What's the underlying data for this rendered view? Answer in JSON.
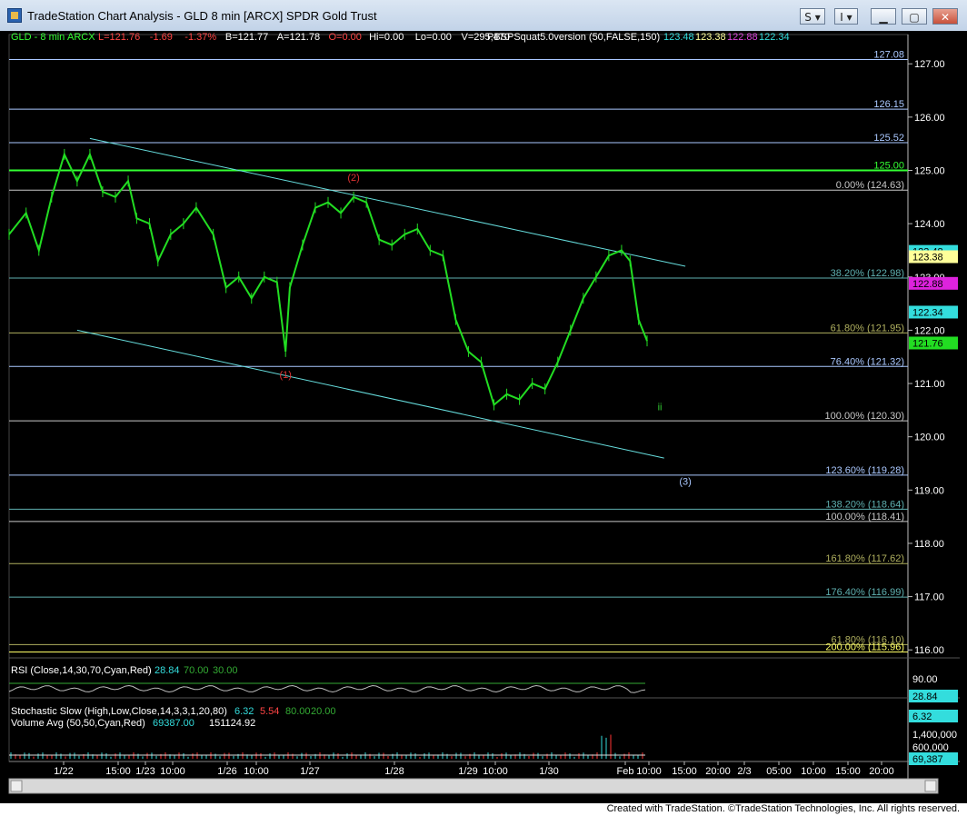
{
  "window": {
    "title": "TradeStation Chart Analysis - GLD 8 min [ARCX] SPDR Gold Trust",
    "btn_s": "S",
    "btn_i": "I",
    "footer": "Created with TradeStation. ©TradeStation Technologies, Inc. All rights reserved."
  },
  "chart_data": {
    "type": "line",
    "symbol": "GLD - 8 min",
    "exchange": "ARCX",
    "header_stats": [
      "L=121.76",
      "-1.69",
      "-1.37%",
      "B=121.77",
      "A=121.78",
      "O=0.00",
      "Hi=0.00",
      "Lo=0.00",
      "V=295,470"
    ],
    "indicator_label": "PBSPSquat5.0version (50,FALSE,150)",
    "indicator_values": [
      "123.48",
      "123.38",
      "122.88",
      "122.34"
    ],
    "y_ticks": [
      127.0,
      126.0,
      125.0,
      124.0,
      123.0,
      122.0,
      121.0,
      120.0,
      119.0,
      118.0,
      117.0,
      116.0
    ],
    "ylim": [
      115.85,
      127.55
    ],
    "x_tick_labels": [
      "1/22",
      "15:00",
      "1/23",
      "10:00",
      "1/26",
      "10:00",
      "1/27",
      "1/28",
      "1/29",
      "10:00",
      "1/30",
      "Feb",
      "10:00",
      "15:00",
      "20:00",
      "2/3",
      "05:00",
      "10:00",
      "15:00",
      "20:00"
    ],
    "levels": [
      {
        "label": "127.08",
        "value": 127.08,
        "color": "#aac8ff"
      },
      {
        "label": "126.15",
        "value": 126.15,
        "color": "#aac8ff"
      },
      {
        "label": "125.52",
        "value": 125.52,
        "color": "#aac8ff"
      },
      {
        "label": "125.00",
        "value": 125.0,
        "color": "#33ff33"
      },
      {
        "label": "0.00% (124.63)",
        "value": 124.63,
        "color": "#c8c8c8"
      },
      {
        "label": "38.20% (122.98)",
        "value": 122.98,
        "color": "#5fb0b0"
      },
      {
        "label": "61.80% (121.95)",
        "value": 121.95,
        "color": "#b0b05f"
      },
      {
        "label": "76.40% (121.32)",
        "value": 121.32,
        "color": "#aac8ff"
      },
      {
        "label": "100.00% (120.30)",
        "value": 120.3,
        "color": "#c8c8c8"
      },
      {
        "label": "123.60% (119.28)",
        "value": 119.28,
        "color": "#aac8ff"
      },
      {
        "label": "138.20% (118.64)",
        "value": 118.64,
        "color": "#5fb0b0"
      },
      {
        "label": "100.00% (118.41)",
        "value": 118.41,
        "color": "#c8c8c8"
      },
      {
        "label": "161.80% (117.62)",
        "value": 117.62,
        "color": "#b0b05f"
      },
      {
        "label": "176.40% (116.99)",
        "value": 116.99,
        "color": "#5fb0b0"
      },
      {
        "label": "61.80% (116.10)",
        "value": 116.1,
        "color": "#b0b05f"
      },
      {
        "label": "200.00% (115.96)",
        "value": 115.96,
        "color": "#ffff66"
      }
    ],
    "price_badges": [
      {
        "label": "123.48",
        "value": 123.48,
        "bg": "#33dddd",
        "fg": "#000000"
      },
      {
        "label": "123.38",
        "value": 123.38,
        "bg": "#ffff99",
        "fg": "#000000"
      },
      {
        "label": "122.88",
        "value": 122.88,
        "bg": "#dd22dd",
        "fg": "#000000"
      },
      {
        "label": "122.34",
        "value": 122.34,
        "bg": "#33dddd",
        "fg": "#000000"
      },
      {
        "label": "121.76",
        "value": 121.76,
        "bg": "#22dd22",
        "fg": "#000000"
      }
    ],
    "wave_labels": [
      {
        "label": "(1)",
        "color": "#dd3333"
      },
      {
        "label": "(2)",
        "color": "#dd3333"
      },
      {
        "label": "ii",
        "color": "#33cc33"
      },
      {
        "label": "(3)",
        "color": "#aac8ff"
      }
    ],
    "price_series": [
      {
        "x": 0,
        "y": 123.8
      },
      {
        "x": 8,
        "y": 124.2
      },
      {
        "x": 14,
        "y": 123.5
      },
      {
        "x": 20,
        "y": 124.5
      },
      {
        "x": 26,
        "y": 125.3
      },
      {
        "x": 32,
        "y": 124.8
      },
      {
        "x": 38,
        "y": 125.3
      },
      {
        "x": 44,
        "y": 124.6
      },
      {
        "x": 50,
        "y": 124.5
      },
      {
        "x": 56,
        "y": 124.8
      },
      {
        "x": 60,
        "y": 124.1
      },
      {
        "x": 66,
        "y": 124.0
      },
      {
        "x": 70,
        "y": 123.3
      },
      {
        "x": 76,
        "y": 123.8
      },
      {
        "x": 82,
        "y": 124.0
      },
      {
        "x": 88,
        "y": 124.3
      },
      {
        "x": 96,
        "y": 123.8
      },
      {
        "x": 102,
        "y": 122.8
      },
      {
        "x": 108,
        "y": 123.0
      },
      {
        "x": 114,
        "y": 122.6
      },
      {
        "x": 120,
        "y": 123.0
      },
      {
        "x": 126,
        "y": 122.9
      },
      {
        "x": 130,
        "y": 121.6
      },
      {
        "x": 132,
        "y": 122.8
      },
      {
        "x": 138,
        "y": 123.6
      },
      {
        "x": 144,
        "y": 124.3
      },
      {
        "x": 150,
        "y": 124.4
      },
      {
        "x": 156,
        "y": 124.2
      },
      {
        "x": 162,
        "y": 124.5
      },
      {
        "x": 168,
        "y": 124.4
      },
      {
        "x": 174,
        "y": 123.7
      },
      {
        "x": 180,
        "y": 123.6
      },
      {
        "x": 186,
        "y": 123.8
      },
      {
        "x": 192,
        "y": 123.9
      },
      {
        "x": 198,
        "y": 123.5
      },
      {
        "x": 204,
        "y": 123.4
      },
      {
        "x": 210,
        "y": 122.2
      },
      {
        "x": 216,
        "y": 121.6
      },
      {
        "x": 222,
        "y": 121.4
      },
      {
        "x": 228,
        "y": 120.6
      },
      {
        "x": 234,
        "y": 120.8
      },
      {
        "x": 240,
        "y": 120.7
      },
      {
        "x": 246,
        "y": 121.0
      },
      {
        "x": 252,
        "y": 120.9
      },
      {
        "x": 258,
        "y": 121.4
      },
      {
        "x": 264,
        "y": 122.0
      },
      {
        "x": 270,
        "y": 122.6
      },
      {
        "x": 276,
        "y": 123.0
      },
      {
        "x": 282,
        "y": 123.4
      },
      {
        "x": 288,
        "y": 123.5
      },
      {
        "x": 292,
        "y": 123.3
      },
      {
        "x": 296,
        "y": 122.2
      },
      {
        "x": 300,
        "y": 121.8
      }
    ],
    "price_x_range": [
      0,
      300
    ],
    "channels": [
      {
        "from": {
          "x": 38,
          "y": 125.6
        },
        "to": {
          "x": 318,
          "y": 123.2
        }
      },
      {
        "from": {
          "x": 32,
          "y": 122.0
        },
        "to": {
          "x": 308,
          "y": 119.6
        }
      }
    ],
    "rsi": {
      "label": "RSI (Close,14,30,70,Cyan,Red)",
      "values": [
        "28.84",
        "70.00",
        "30.00"
      ],
      "axis_label": "90.00",
      "current": "28.84"
    },
    "stochastic": {
      "label": "Stochastic Slow (High,Low,Close,14,3,3,1,20,80)",
      "values": [
        "6.32",
        "5.54",
        "80.00",
        "20.00"
      ],
      "current": "6.32"
    },
    "volume": {
      "label": "Volume Avg (50,50,Cyan,Red)",
      "values": [
        "69387.00",
        "151124.92"
      ],
      "axis_labels": [
        "1,400,000",
        "600,000"
      ],
      "current": "69,387"
    },
    "grid": false
  }
}
